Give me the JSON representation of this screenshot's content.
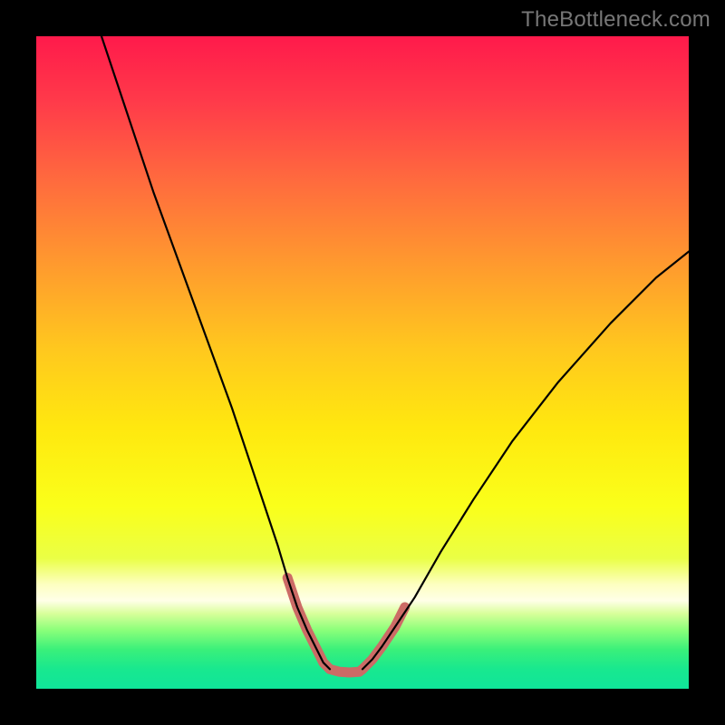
{
  "watermark": {
    "text": "TheBottleneck.com"
  },
  "gradient": {
    "stops": [
      {
        "offset": 0.0,
        "color": "#ff1a4b"
      },
      {
        "offset": 0.1,
        "color": "#ff3a4a"
      },
      {
        "offset": 0.22,
        "color": "#ff6a3e"
      },
      {
        "offset": 0.35,
        "color": "#ff9a2e"
      },
      {
        "offset": 0.48,
        "color": "#ffc81e"
      },
      {
        "offset": 0.6,
        "color": "#ffe80f"
      },
      {
        "offset": 0.72,
        "color": "#faff1a"
      },
      {
        "offset": 0.8,
        "color": "#eaff45"
      },
      {
        "offset": 0.84,
        "color": "#fdffc0"
      },
      {
        "offset": 0.865,
        "color": "#ffffe8"
      },
      {
        "offset": 0.885,
        "color": "#d8ff9a"
      },
      {
        "offset": 0.91,
        "color": "#8bff7a"
      },
      {
        "offset": 0.94,
        "color": "#3af07a"
      },
      {
        "offset": 0.97,
        "color": "#18e88f"
      },
      {
        "offset": 1.0,
        "color": "#10e59a"
      }
    ]
  },
  "chart_data": {
    "type": "line",
    "title": "",
    "xlabel": "",
    "ylabel": "",
    "xlim": [
      0,
      100
    ],
    "ylim": [
      0,
      100
    ],
    "series": [
      {
        "name": "left-branch",
        "x": [
          10,
          14,
          18,
          22,
          26,
          30,
          33,
          35,
          37,
          38.5,
          40,
          41.5,
          43,
          44,
          45
        ],
        "y": [
          100,
          88,
          76,
          65,
          54,
          43,
          34,
          28,
          22,
          17,
          12.5,
          9,
          6,
          4,
          3
        ],
        "stroke": "#000000",
        "width": 2.2
      },
      {
        "name": "right-branch",
        "x": [
          50,
          51.5,
          53,
          55,
          58,
          62,
          67,
          73,
          80,
          88,
          95,
          100
        ],
        "y": [
          3,
          4.5,
          6.5,
          9.5,
          14,
          21,
          29,
          38,
          47,
          56,
          63,
          67
        ],
        "stroke": "#000000",
        "width": 2.2
      },
      {
        "name": "trough-marker-left",
        "x": [
          38.5,
          40,
          41.5,
          43,
          44,
          45
        ],
        "y": [
          17,
          12.5,
          9,
          6,
          4,
          3
        ],
        "stroke": "#cc6b66",
        "width": 11
      },
      {
        "name": "trough-marker-flat",
        "x": [
          45,
          46.5,
          48,
          49.5,
          50
        ],
        "y": [
          3,
          2.6,
          2.5,
          2.6,
          3
        ],
        "stroke": "#cc6b66",
        "width": 11
      },
      {
        "name": "trough-marker-right",
        "x": [
          50,
          51.5,
          53,
          55,
          56.5
        ],
        "y": [
          3,
          4.5,
          6.5,
          9.5,
          12.5
        ],
        "stroke": "#cc6b66",
        "width": 11
      }
    ]
  }
}
